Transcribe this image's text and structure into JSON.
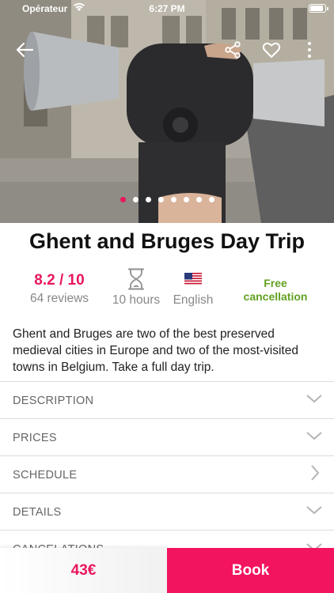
{
  "status_bar": {
    "carrier": "Opérateur",
    "time": "6:27 PM"
  },
  "hero": {
    "image_icon": "binoculars-photo",
    "slide_count": 8,
    "active_slide": 1
  },
  "toolbar": {
    "back_icon": "arrow-left-icon",
    "share_icon": "share-icon",
    "favorite_icon": "heart-icon",
    "more_icon": "more-vertical-icon"
  },
  "tour": {
    "title": "Ghent and Bruges Day Trip",
    "rating": "8.2 / 10",
    "reviews": "64 reviews",
    "duration": "10 hours",
    "language": "English",
    "cancellation": "Free cancellation",
    "description": "Ghent and Bruges are two of the best preserved medieval cities in Europe and two of the most-visited towns in Belgium. Take a full day trip."
  },
  "sections": [
    {
      "label": "DESCRIPTION",
      "icon": "chevron-down-icon"
    },
    {
      "label": "PRICES",
      "icon": "chevron-down-icon"
    },
    {
      "label": "SCHEDULE",
      "icon": "chevron-right-icon"
    },
    {
      "label": "DETAILS",
      "icon": "chevron-down-icon"
    },
    {
      "label": "CANCELATIONS",
      "icon": "chevron-down-icon"
    }
  ],
  "booking": {
    "price": "43€",
    "book_label": "Book"
  },
  "colors": {
    "accent": "#e8175d",
    "free_cancel": "#62a121"
  }
}
